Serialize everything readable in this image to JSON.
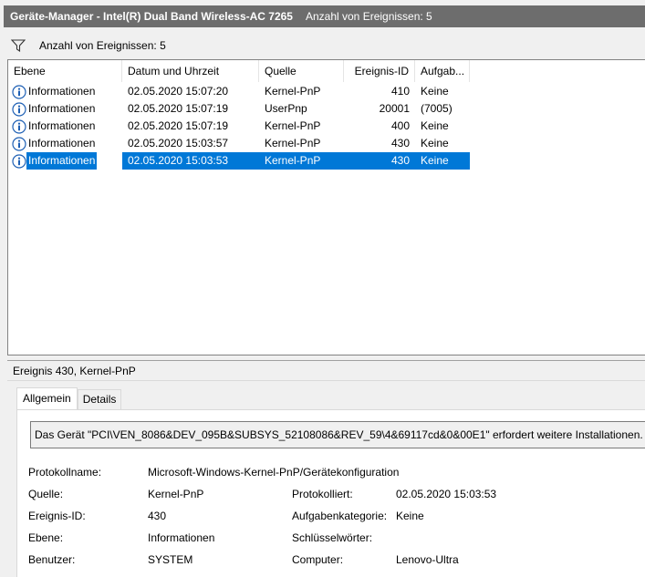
{
  "window": {
    "title": "Geräte-Manager - Intel(R) Dual Band Wireless-AC 7265",
    "count_label": "Anzahl von Ereignissen: 5"
  },
  "filterbar": {
    "label": "Anzahl von Ereignissen: 5",
    "icon": "filter-icon"
  },
  "list": {
    "columns": [
      "Ebene",
      "Datum und Uhrzeit",
      "Quelle",
      "Ereignis-ID",
      "Aufgab..."
    ],
    "rows": [
      {
        "level": "Informationen",
        "date": "02.05.2020 15:07:20",
        "source": "Kernel-PnP",
        "id": "410",
        "task": "Keine"
      },
      {
        "level": "Informationen",
        "date": "02.05.2020 15:07:19",
        "source": "UserPnp",
        "id": "20001",
        "task": "(7005)"
      },
      {
        "level": "Informationen",
        "date": "02.05.2020 15:07:19",
        "source": "Kernel-PnP",
        "id": "400",
        "task": "Keine"
      },
      {
        "level": "Informationen",
        "date": "02.05.2020 15:03:57",
        "source": "Kernel-PnP",
        "id": "430",
        "task": "Keine"
      },
      {
        "level": "Informationen",
        "date": "02.05.2020 15:03:53",
        "source": "Kernel-PnP",
        "id": "430",
        "task": "Keine"
      }
    ],
    "selected_index": 4
  },
  "detail": {
    "header": "Ereignis 430, Kernel-PnP",
    "tabs": [
      "Allgemein",
      "Details"
    ],
    "active_tab": "Allgemein",
    "description": "Das Gerät \"PCI\\VEN_8086&DEV_095B&SUBSYS_52108086&REV_59\\4&69117cd&0&00E1\" erfordert weitere Installationen.",
    "props": {
      "protokollname_label": "Protokollname:",
      "protokollname_value": "Microsoft-Windows-Kernel-PnP/Gerätekonfiguration",
      "quelle_label": "Quelle:",
      "quelle_value": "Kernel-PnP",
      "protokolliert_label": "Protokolliert:",
      "protokolliert_value": "02.05.2020 15:03:53",
      "ereignis_label": "Ereignis-ID:",
      "ereignis_value": "430",
      "aufgabe_label": "Aufgabenkategorie:",
      "aufgabe_value": "Keine",
      "ebene_label": "Ebene:",
      "ebene_value": "Informationen",
      "schluessel_label": "Schlüsselwörter:",
      "schluessel_value": "",
      "benutzer_label": "Benutzer:",
      "benutzer_value": "SYSTEM",
      "computer_label": "Computer:",
      "computer_value": "Lenovo-Ultra"
    }
  },
  "colors": {
    "selection": "#0078d7",
    "titlebar": "#6d6d6d",
    "info_icon": "#1d5fb4"
  }
}
